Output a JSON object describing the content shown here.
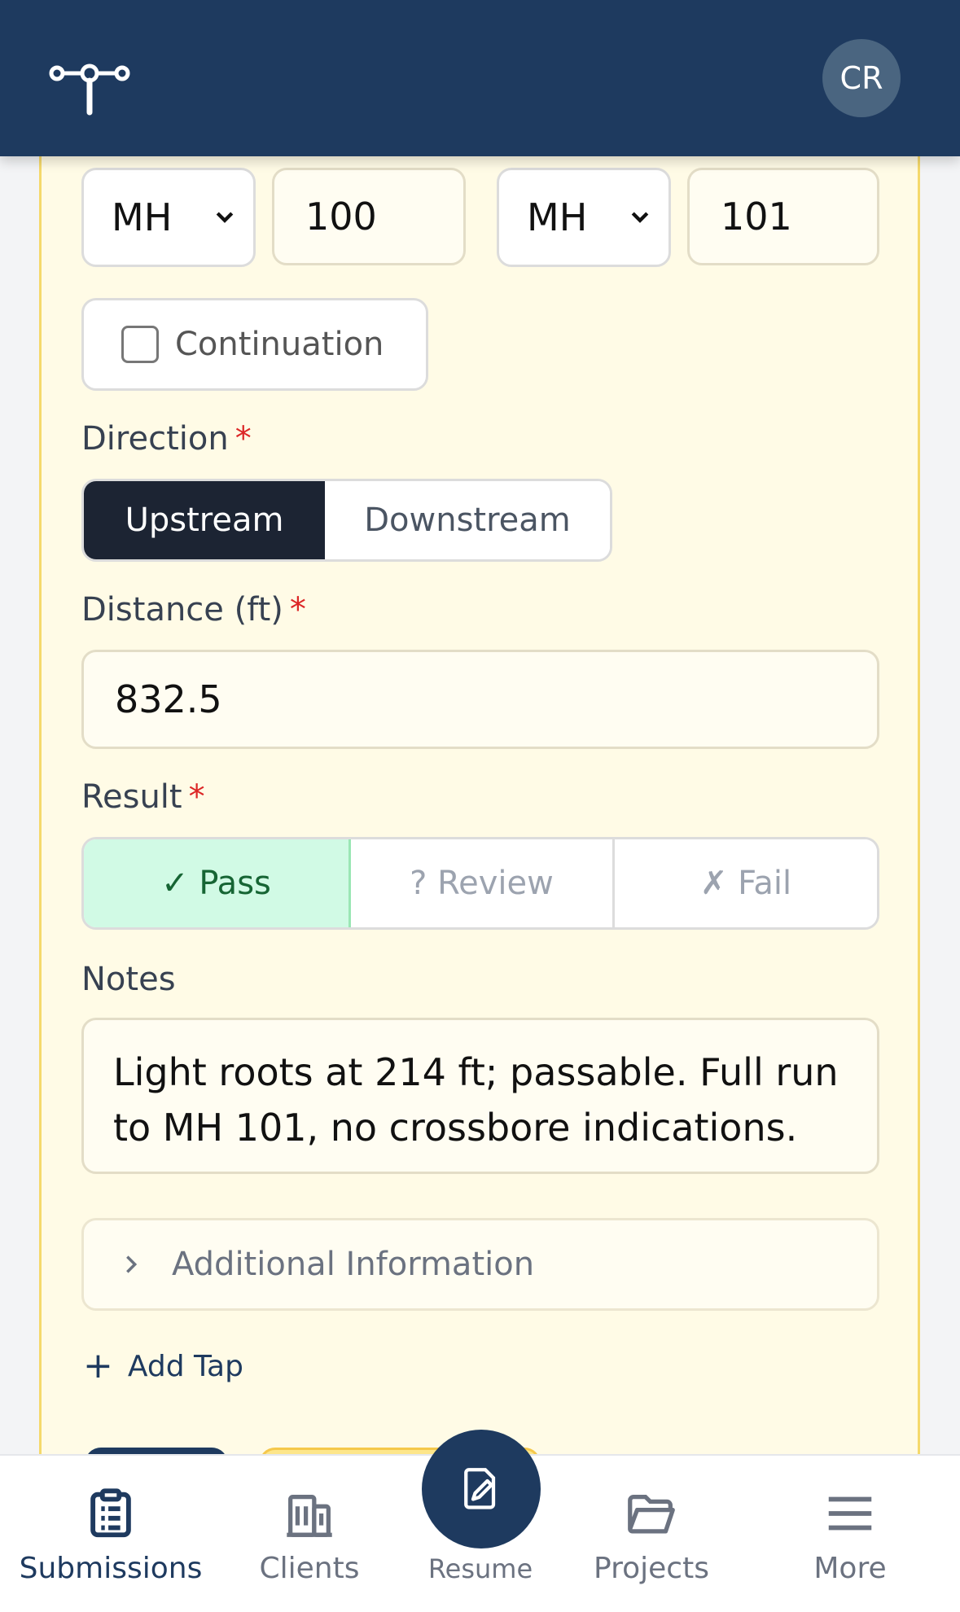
{
  "header": {
    "avatar_initials": "CR",
    "logo_icon": "pipe-junction-icon"
  },
  "line_segment": {
    "from_type": "MH",
    "from_id": "100",
    "to_type": "MH",
    "to_id": "101",
    "continuation_label": "Continuation",
    "continuation_checked": false
  },
  "direction": {
    "label": "Direction",
    "required_mark": "*",
    "options": [
      "Upstream",
      "Downstream"
    ],
    "selected": "Upstream"
  },
  "distance": {
    "label": "Distance (ft)",
    "required_mark": "*",
    "value": "832.5"
  },
  "result": {
    "label": "Result",
    "required_mark": "*",
    "options": [
      "✓ Pass",
      "? Review",
      "✗ Fail"
    ],
    "selected": "✓ Pass"
  },
  "notes": {
    "label": "Notes",
    "value": "Light roots at 214 ft; passable. Full run to MH 101, no crossbore indications."
  },
  "additional_info": {
    "label": "Additional Information"
  },
  "add_tap": {
    "icon": "+",
    "label": "Add Tap"
  },
  "bottom_nav": {
    "items": [
      {
        "label": "Submissions",
        "icon": "clipboard-icon",
        "active": true
      },
      {
        "label": "Clients",
        "icon": "building-icon",
        "active": false
      },
      {
        "label": "Resume",
        "icon": "edit-document-icon",
        "active": false
      },
      {
        "label": "Projects",
        "icon": "folder-icon",
        "active": false
      },
      {
        "label": "More",
        "icon": "menu-icon",
        "active": false
      }
    ]
  },
  "colors": {
    "header_bg": "#1e3a5f",
    "card_bg": "#fffbe6",
    "pass_bg": "#d1fae5",
    "required": "#dc2626"
  }
}
